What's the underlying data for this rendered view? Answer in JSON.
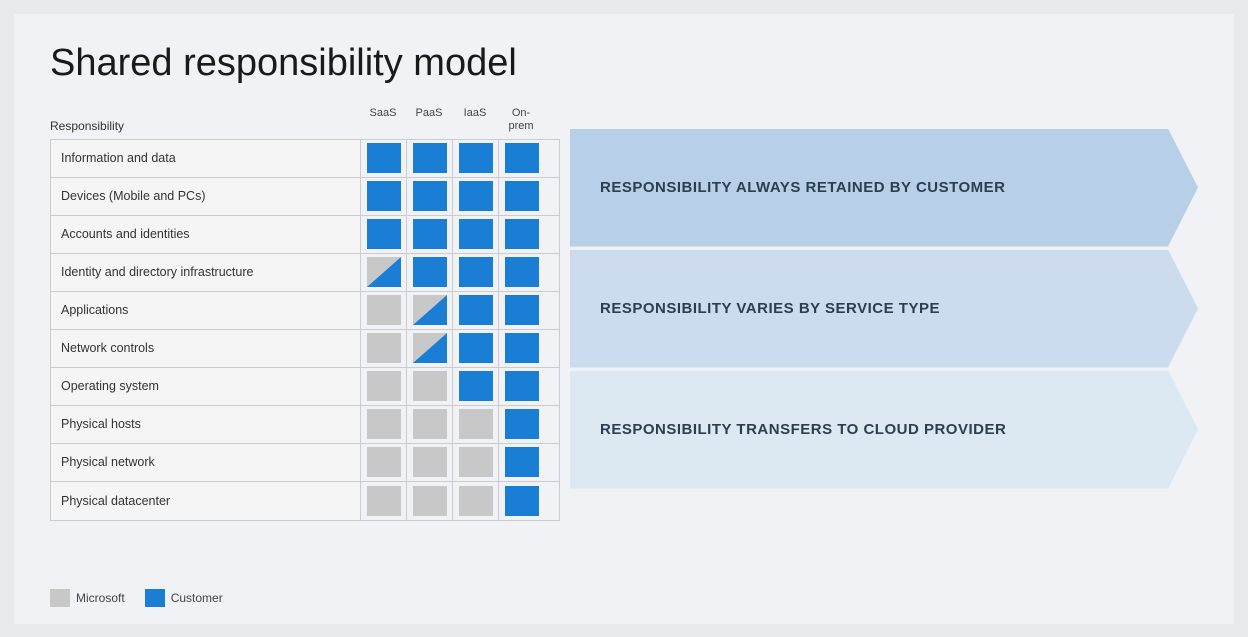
{
  "slide": {
    "title": "Shared responsibility model",
    "table": {
      "header": {
        "label": "Responsibility",
        "columns": [
          "SaaS",
          "PaaS",
          "IaaS",
          "On-prem"
        ]
      },
      "rows": [
        {
          "label": "Information and data",
          "cells": [
            "blue",
            "blue",
            "blue",
            "blue"
          ]
        },
        {
          "label": "Devices (Mobile and PCs)",
          "cells": [
            "blue",
            "blue",
            "blue",
            "blue"
          ]
        },
        {
          "label": "Accounts and identities",
          "cells": [
            "blue",
            "blue",
            "blue",
            "blue"
          ]
        },
        {
          "label": "Identity and directory infrastructure",
          "cells": [
            "half",
            "blue",
            "blue",
            "blue"
          ]
        },
        {
          "label": "Applications",
          "cells": [
            "gray",
            "half",
            "blue",
            "blue"
          ]
        },
        {
          "label": "Network controls",
          "cells": [
            "gray",
            "half",
            "blue",
            "blue"
          ]
        },
        {
          "label": "Operating system",
          "cells": [
            "gray",
            "gray",
            "blue",
            "blue"
          ]
        },
        {
          "label": "Physical hosts",
          "cells": [
            "gray",
            "gray",
            "gray",
            "blue"
          ]
        },
        {
          "label": "Physical network",
          "cells": [
            "gray",
            "gray",
            "gray",
            "blue"
          ]
        },
        {
          "label": "Physical datacenter",
          "cells": [
            "gray",
            "gray",
            "gray",
            "blue"
          ]
        }
      ]
    },
    "arrows": [
      {
        "text": "RESPONSIBILITY ALWAYS RETAINED BY CUSTOMER",
        "shade": "top"
      },
      {
        "text": "RESPONSIBILITY VARIES BY SERVICE TYPE",
        "shade": "middle"
      },
      {
        "text": "RESPONSIBILITY TRANSFERS TO CLOUD PROVIDER",
        "shade": "bottom"
      }
    ],
    "legend": {
      "microsoft_label": "Microsoft",
      "customer_label": "Customer"
    }
  }
}
